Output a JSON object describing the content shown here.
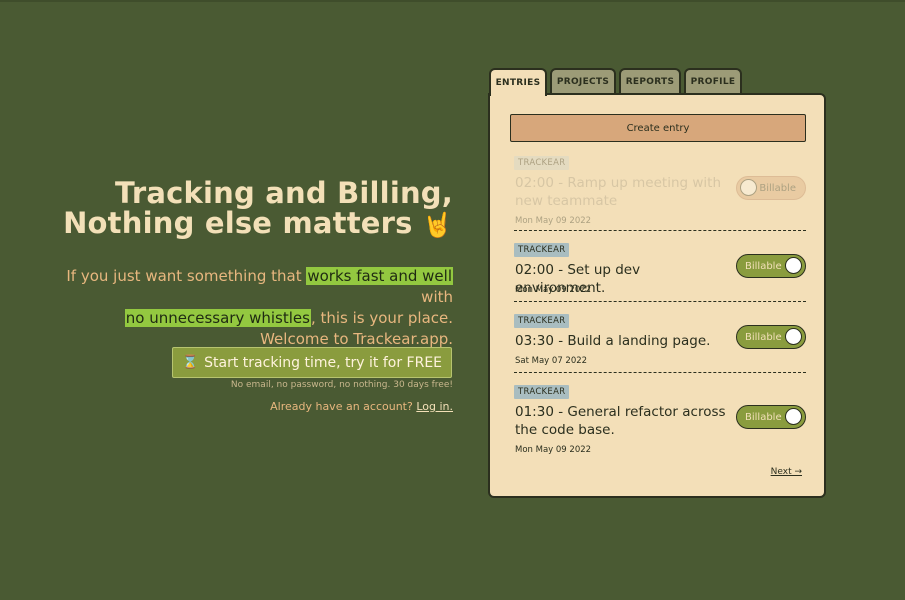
{
  "hero": {
    "title_line1": "Tracking and Billing,",
    "title_line2": "Nothing else matters",
    "title_emoji": "🤘",
    "desc_part1": "If you just want something that ",
    "desc_highlight1": "works fast and well",
    "desc_part2": " with",
    "desc_highlight2": "no unnecessary whistles",
    "desc_part3": ", this is your place.",
    "desc_line3": "Welcome to Trackear.app.",
    "cta_icon": "⌛",
    "cta_label": "Start tracking time, try it for FREE",
    "cta_note": "No email, no password, no nothing. 30 days free!",
    "login_prompt": "Already have an account?",
    "login_link": "Log in."
  },
  "tabs": [
    {
      "label": "ENTRIES",
      "active": true
    },
    {
      "label": "PROJECTS",
      "active": false
    },
    {
      "label": "REPORTS",
      "active": false
    },
    {
      "label": "PROFILE",
      "active": false
    }
  ],
  "panel": {
    "create_label": "Create entry",
    "entries": [
      {
        "project": "TRACKEAR",
        "title": "02:00 - Ramp up meeting with new teammate",
        "date": "Mon May 09 2022",
        "billable_label": "Billable",
        "billable": false,
        "faded": true
      },
      {
        "project": "TRACKEAR",
        "title": "02:00 - Set up dev environment.",
        "date": "Mon May 09 2022",
        "billable_label": "Billable",
        "billable": true,
        "faded": false
      },
      {
        "project": "TRACKEAR",
        "title": "03:30 - Build a landing page.",
        "date": "Sat May 07 2022",
        "billable_label": "Billable",
        "billable": true,
        "faded": false
      },
      {
        "project": "TRACKEAR",
        "title": "01:30 - General refactor across the code base.",
        "date": "Mon May 09 2022",
        "billable_label": "Billable",
        "billable": true,
        "faded": false
      }
    ],
    "next_label": "Next →"
  },
  "colors": {
    "background": "#4a5a33",
    "panel": "#f3dfb8",
    "accent_green": "#8a9c3e",
    "accent_tan": "#d7a77b",
    "highlight": "#93c840"
  }
}
